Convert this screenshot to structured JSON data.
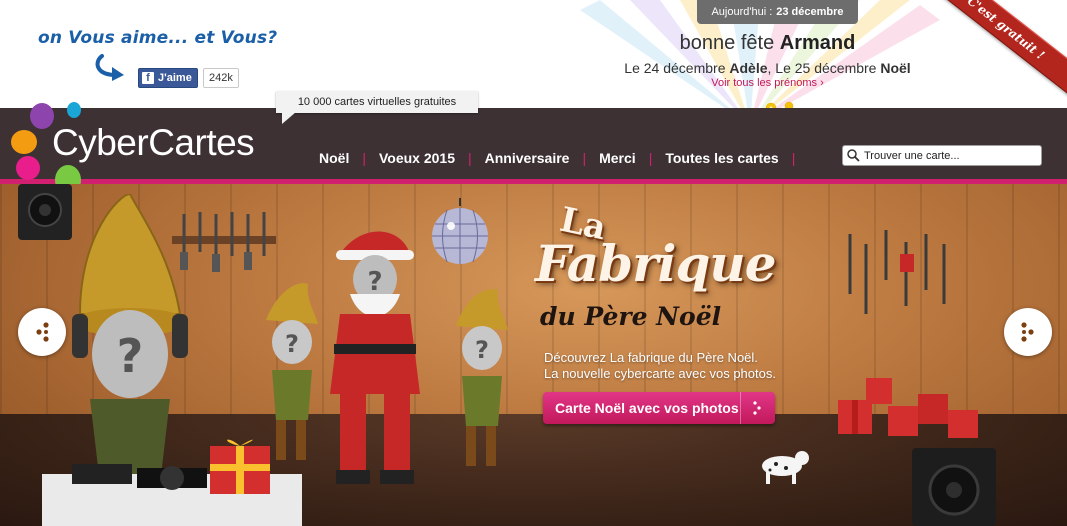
{
  "topbar": {
    "tagline": "on Vous aime... et Vous?",
    "facebook": {
      "like_label": "J'aime",
      "count": "242k"
    },
    "today_prefix": "Aujourd'hui :",
    "today_date": "23 décembre",
    "fete_prefix": "bonne fête",
    "fete_name": "Armand",
    "next_1_date": "Le 24 décembre",
    "next_1_name": "Adèle",
    "next_sep": ",",
    "next_2_date": "Le 25 décembre",
    "next_2_name": "Noël",
    "all_names_link": "Voir tous les prénoms",
    "ribbon": "C'est gratuit !"
  },
  "header": {
    "logo_text": "CyberCartes",
    "tooltip": "10 000 cartes virtuelles gratuites",
    "nav": [
      "Noël",
      "Voeux 2015",
      "Anniversaire",
      "Merci",
      "Toutes les cartes"
    ],
    "search_placeholder": "Trouver une carte..."
  },
  "banner": {
    "title_la": "La",
    "title_fabrique": "Fabrique",
    "title_pere": "du Père Noël",
    "desc_line1": "Découvrez La fabrique du Père Noël.",
    "desc_line2": "La nouvelle cybercarte avec vos photos.",
    "cta_label": "Carte Noël avec vos photos"
  },
  "colors": {
    "nav_bg": "#3d3134",
    "accent_pink": "#d1206f",
    "link_blue": "#1a5fa8",
    "ribbon_red": "#b3261e"
  },
  "icons": [
    "curved-arrow-icon",
    "facebook-icon",
    "search-icon",
    "prev-arrow-icon",
    "next-arrow-icon",
    "cta-arrow-icon"
  ]
}
